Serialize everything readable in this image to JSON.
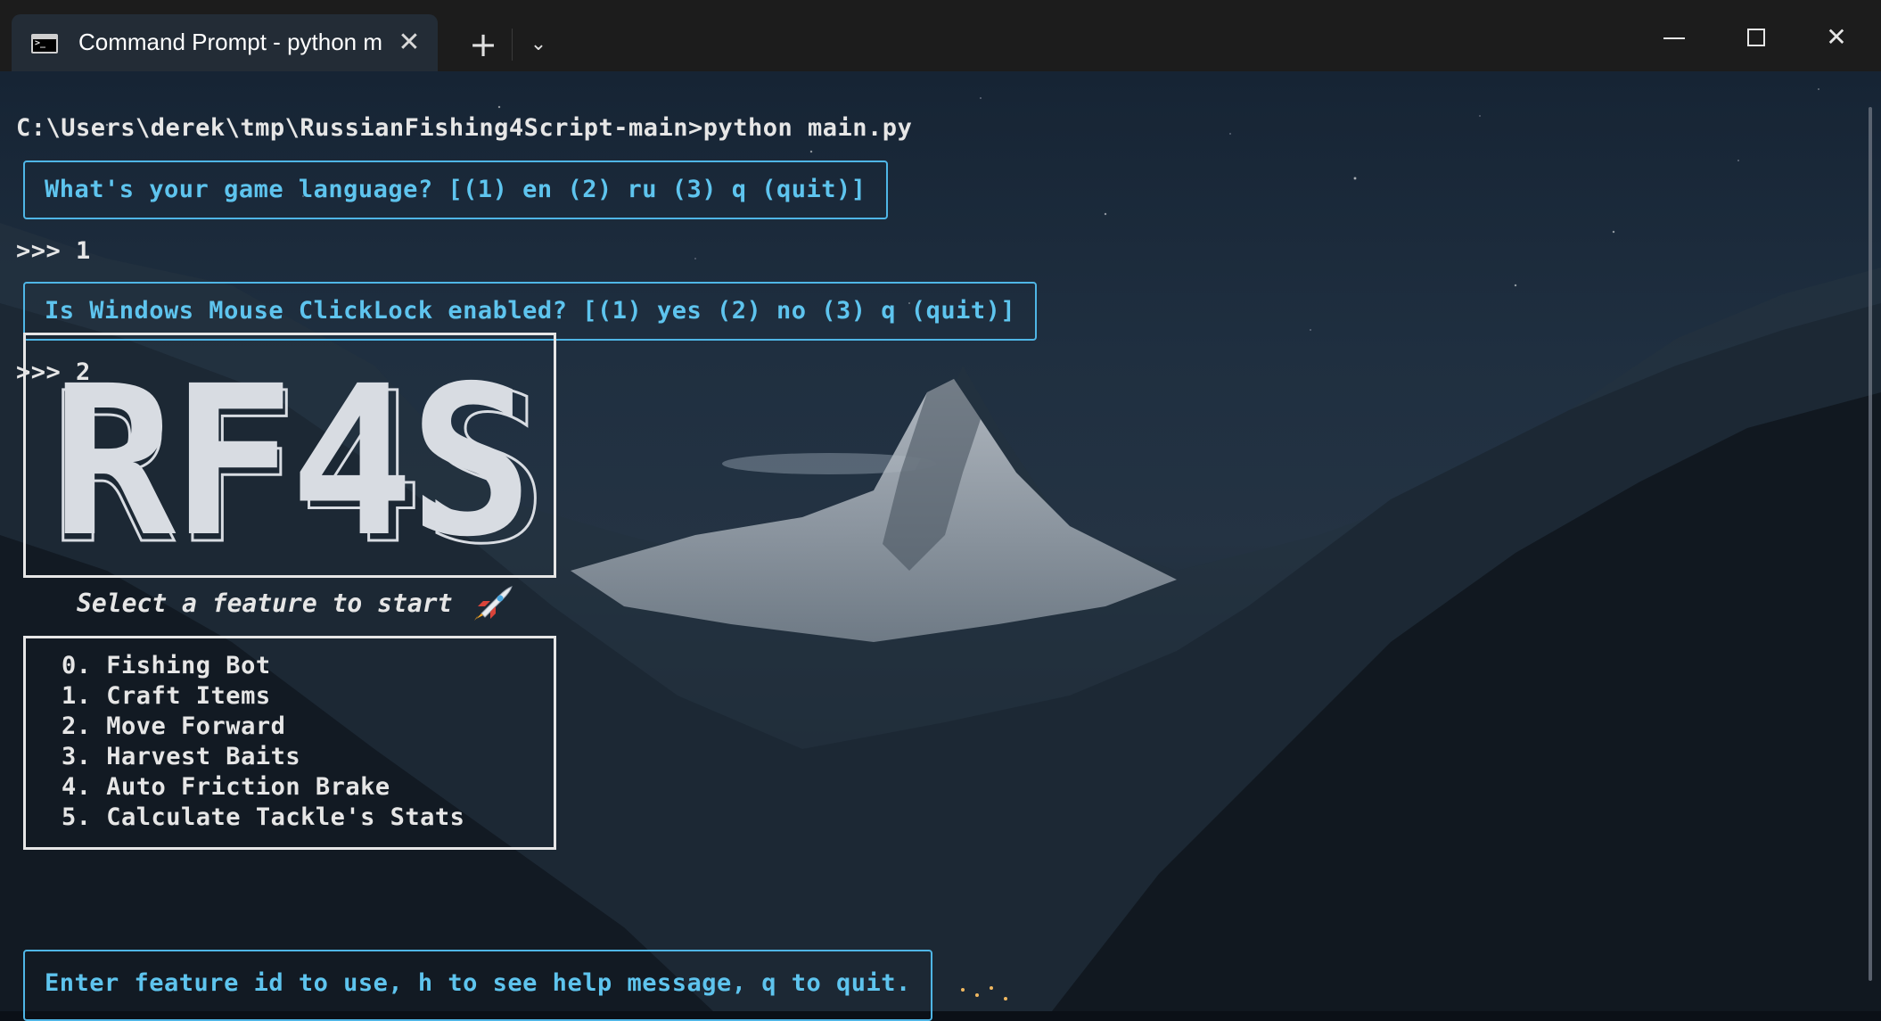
{
  "window": {
    "tab_title": "Command Prompt - python main.py",
    "tab_close": "✕",
    "new_tab": "+",
    "dropdown": "⌄",
    "close": "✕"
  },
  "terminal": {
    "command_line": "C:\\Users\\derek\\tmp\\RussianFishing4Script-main>python main.py",
    "language_prompt": "What's your game language? [(1) en (2) ru (3) q (quit)]",
    "language_answer": ">>> 1",
    "clicklock_prompt": "Is Windows Mouse ClickLock enabled? [(1) yes (2) no (3) q (quit)]",
    "clicklock_answer": ">>> 2",
    "logo_text": "RF4S",
    "tagline": "Select a feature to start",
    "menu": [
      {
        "label": "0. Fishing Bot"
      },
      {
        "label": "1. Craft Items"
      },
      {
        "label": "2. Move Forward"
      },
      {
        "label": "3. Harvest Baits"
      },
      {
        "label": "4. Auto Friction Brake"
      },
      {
        "label": "5. Calculate Tackle's Stats"
      }
    ],
    "input_prompt": "Enter feature id to use, h to see help message, q to quit."
  },
  "colors": {
    "prompt_accent": "#5ec4ee",
    "text": "#e6e6e6",
    "titlebar": "#1c1c1c",
    "tab": "#232c36"
  },
  "icons": {
    "tab": "terminal-icon",
    "tagline": "rocket-icon"
  }
}
